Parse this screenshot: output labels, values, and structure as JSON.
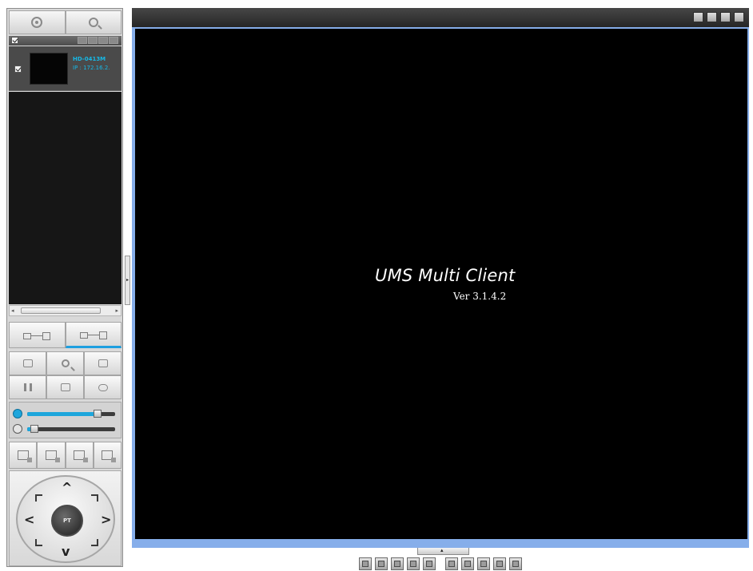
{
  "left_panel": {
    "top_tabs": [
      {
        "icon": "target-icon"
      },
      {
        "icon": "search-icon"
      }
    ],
    "device": {
      "name": "HD-0413M",
      "ip": "IP : 172.16.2."
    },
    "mode_buttons": [
      {
        "icon": "connect-icon",
        "selected": false
      },
      {
        "icon": "multi-connect-icon",
        "selected": true
      }
    ],
    "controls": [
      {
        "icon": "layout-icon"
      },
      {
        "icon": "zoom-icon"
      },
      {
        "icon": "tree-icon"
      },
      {
        "icon": "pause-icon"
      },
      {
        "icon": "stop-icon"
      },
      {
        "icon": "link-icon"
      }
    ],
    "sliders": {
      "volume": 0.8,
      "speed": 0.05
    },
    "presets": [
      {
        "icon": "preset-camera-icon"
      },
      {
        "icon": "preset-camera-icon"
      },
      {
        "icon": "preset-camera-icon"
      },
      {
        "icon": "preset-camera-icon"
      }
    ],
    "ptz": {
      "label": "PT"
    }
  },
  "viewer": {
    "title": "UMS Multi Client",
    "version": "Ver 3.1.4.2",
    "window_buttons": [
      "grid-icon",
      "minimize-icon",
      "restore-icon",
      "close-icon"
    ],
    "colors": {
      "frame": "#86aeea",
      "titlebar": "#2f2f2f",
      "background": "#000000",
      "accent": "#16b8e6"
    }
  },
  "layout_bar": {
    "buttons": [
      "layout-1-icon",
      "layout-4-icon",
      "layout-6-icon",
      "layout-9-icon",
      "layout-seq-icon",
      "layout-a-icon",
      "layout-b-icon",
      "layout-c-icon",
      "layout-d-icon",
      "layout-e-icon"
    ]
  }
}
